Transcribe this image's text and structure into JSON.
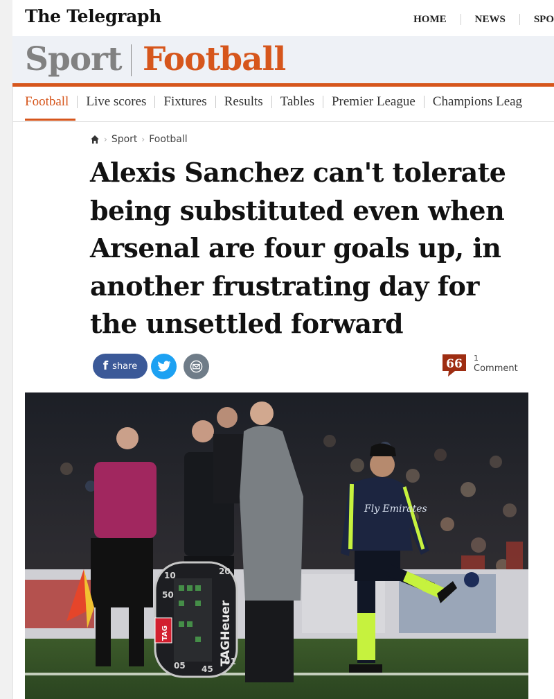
{
  "masthead": {
    "logo": "The Telegraph",
    "nav": [
      "HOME",
      "NEWS",
      "SPO"
    ]
  },
  "section": {
    "parent": "Sport",
    "current": "Football"
  },
  "subnav": {
    "items": [
      "Football",
      "Live scores",
      "Fixtures",
      "Results",
      "Tables",
      "Premier League",
      "Champions Leag"
    ]
  },
  "breadcrumb": {
    "items": [
      "Sport",
      "Football"
    ]
  },
  "article": {
    "headline": "Alexis Sanchez can't tolerate being substituted even when Arsenal are four goals up, in another frustrating day for the unsettled forward"
  },
  "share": {
    "facebook_label": "share",
    "comment_count": "1",
    "comment_label": "Comment"
  },
  "photo": {
    "board_brand": "TAGHeuer",
    "board_badge": "TAG",
    "board_numbers": [
      "10",
      "20",
      "50",
      "45",
      "05",
      "01"
    ],
    "shirt_sponsor": "Fly Emirates"
  },
  "colors": {
    "accent": "#d6561c",
    "facebook": "#3b5998",
    "twitter": "#1da1f2",
    "email": "#6f7c88",
    "comment": "#9e2d12",
    "section_band": "#eef1f6"
  }
}
